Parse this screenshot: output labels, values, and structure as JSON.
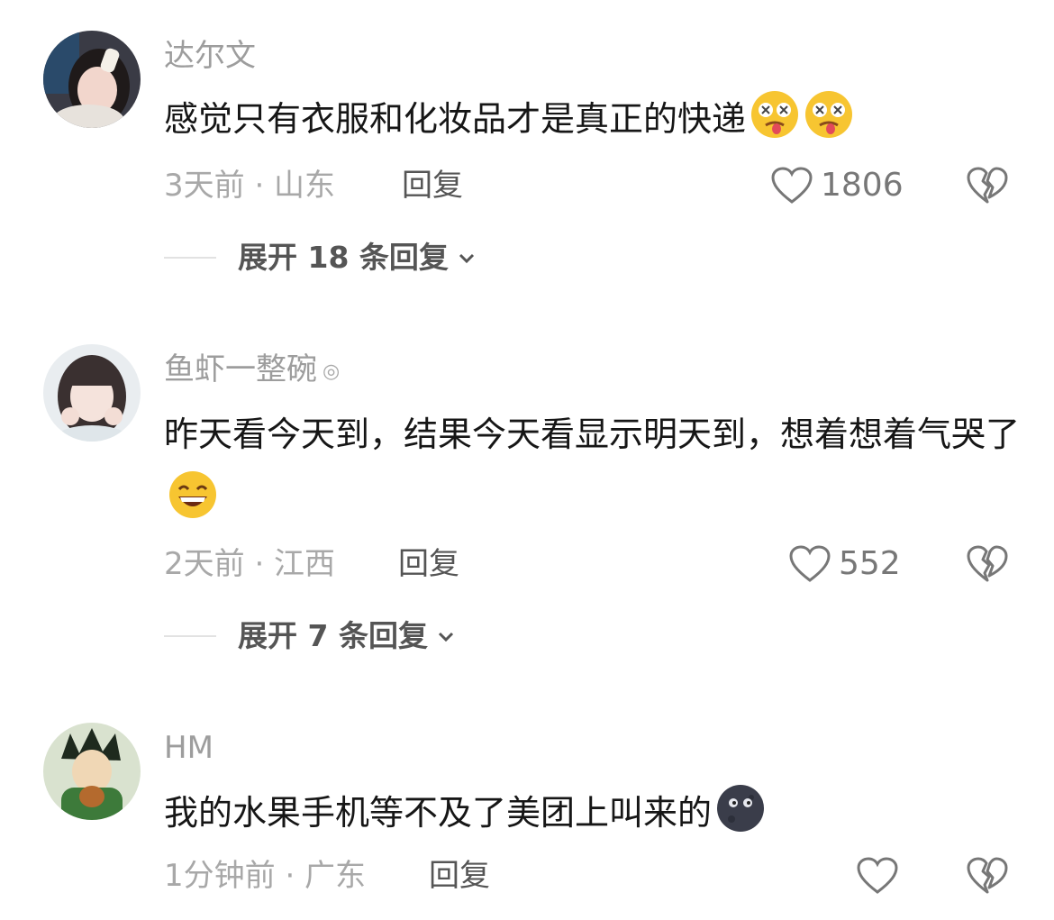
{
  "comments": [
    {
      "username": "达尔文",
      "text": "感觉只有衣服和化妆品才是真正的快递",
      "time_location": "3天前 · 山东",
      "reply_label": "回复",
      "likes": "1806",
      "expand_label": "展开 18 条回复",
      "emoji_name": "woozy-face-icon"
    },
    {
      "username": "鱼虾一整碗",
      "badge": "◎",
      "text": "昨天看今天到，结果今天看显示明天到，想着想着气哭了",
      "time_location": "2天前 · 江西",
      "reply_label": "回复",
      "likes": "552",
      "expand_label": "展开 7 条回复",
      "emoji_name": "grinning-face-icon"
    },
    {
      "username": "HM",
      "text": "我的水果手机等不及了美团上叫来的",
      "time_location": "1分钟前 · 广东",
      "reply_label": "回复",
      "likes": "",
      "emoji_name": "new-moon-face-icon"
    }
  ],
  "colors": {
    "background": "#ffffff",
    "username": "#9d9d9d",
    "text": "#161616",
    "meta": "#a8a8a8",
    "action": "#555555"
  }
}
